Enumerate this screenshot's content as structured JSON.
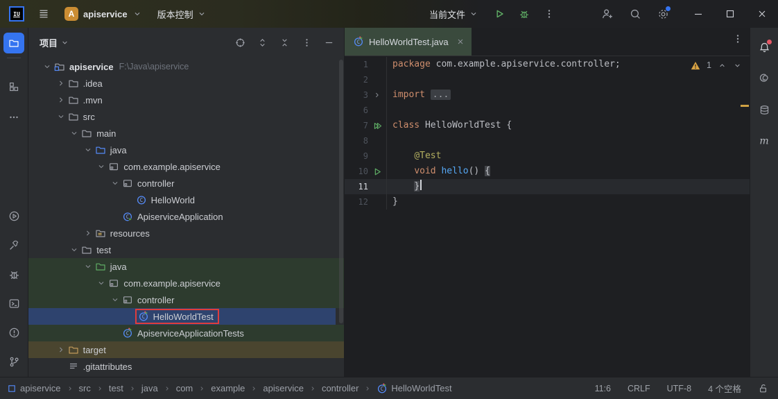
{
  "titlebar": {
    "project_name": "apiservice",
    "vcs_menu": "版本控制",
    "run_config": "当前文件",
    "avatar_letter": "A",
    "logo_text": "IU"
  },
  "colors": {
    "accent": "#3574f0",
    "selection_row": "#2e436e",
    "test_scope_row": "#2d3b2e",
    "excluded_row": "#4a452f",
    "active_tab": "#3a4a3d",
    "warning": "#d9a343",
    "annotation_box": "#e03c3c",
    "run_green": "#5fad65"
  },
  "left_stripe": {
    "top": [
      {
        "icon": "project-folder",
        "active": true
      },
      {
        "icon": "structure"
      },
      {
        "icon": "more-horizontal"
      }
    ],
    "bottom": [
      {
        "icon": "run"
      },
      {
        "icon": "build-hammer"
      },
      {
        "icon": "debug-bug"
      },
      {
        "icon": "terminal"
      },
      {
        "icon": "problems"
      },
      {
        "icon": "version-control"
      }
    ]
  },
  "right_stripe": [
    {
      "icon": "notifications",
      "badge": true
    },
    {
      "icon": "ai-assistant"
    },
    {
      "icon": "database"
    },
    {
      "icon": "maven"
    }
  ],
  "project_panel": {
    "title": "项目",
    "header_icons": [
      "locate",
      "expand-all",
      "collapse-all",
      "more-vertical",
      "hide"
    ],
    "tree": [
      {
        "level": 0,
        "chevron": "down",
        "icon": "project-root",
        "label": "apiservice",
        "root": true,
        "extra": "F:\\Java\\apiservice"
      },
      {
        "level": 1,
        "chevron": "right",
        "icon": "folder",
        "label": ".idea"
      },
      {
        "level": 1,
        "chevron": "right",
        "icon": "folder",
        "label": ".mvn"
      },
      {
        "level": 1,
        "chevron": "down",
        "icon": "folder",
        "label": "src"
      },
      {
        "level": 2,
        "chevron": "down",
        "icon": "folder",
        "label": "main"
      },
      {
        "level": 3,
        "chevron": "down",
        "icon": "folder-blue",
        "label": "java"
      },
      {
        "level": 4,
        "chevron": "down",
        "icon": "package",
        "label": "com.example.apiservice"
      },
      {
        "level": 5,
        "chevron": "down",
        "icon": "package",
        "label": "controller"
      },
      {
        "level": 6,
        "chevron": null,
        "icon": "class",
        "label": "HelloWorld"
      },
      {
        "level": 5,
        "chevron": null,
        "icon": "class-app",
        "label": "ApiserviceApplication"
      },
      {
        "level": 3,
        "chevron": "right",
        "icon": "folder-resources",
        "label": "resources"
      },
      {
        "level": 2,
        "chevron": "down",
        "icon": "folder",
        "label": "test"
      },
      {
        "level": 3,
        "chevron": "down",
        "icon": "folder-green",
        "label": "java",
        "bg": "green"
      },
      {
        "level": 4,
        "chevron": "down",
        "icon": "package",
        "label": "com.example.apiservice",
        "bg": "green"
      },
      {
        "level": 5,
        "chevron": "down",
        "icon": "package",
        "label": "controller",
        "bg": "green"
      },
      {
        "level": 6,
        "chevron": null,
        "icon": "class-test",
        "label": "HelloWorldTest",
        "bg": "selected",
        "boxed": true
      },
      {
        "level": 5,
        "chevron": null,
        "icon": "class-test",
        "label": "ApiserviceApplicationTests",
        "bg": "green"
      },
      {
        "level": 1,
        "chevron": "right",
        "icon": "folder-excluded",
        "label": "target",
        "bg": "excluded"
      },
      {
        "level": 1,
        "chevron": null,
        "icon": "file-text",
        "label": ".gitattributes"
      }
    ]
  },
  "editor": {
    "tab_label": "HelloWorldTest.java",
    "inspection_count": "1",
    "lines": [
      {
        "num": "1",
        "seg": [
          [
            "kw",
            "package"
          ],
          [
            "pl",
            " com.example.apiservice.controller;"
          ]
        ]
      },
      {
        "num": "2",
        "seg": []
      },
      {
        "num": "3",
        "gutter": "fold",
        "seg": [
          [
            "kw",
            "import"
          ],
          [
            "pl",
            " "
          ],
          [
            "fold",
            "..."
          ]
        ]
      },
      {
        "num": "6",
        "seg": []
      },
      {
        "num": "7",
        "gutter": "run-class",
        "seg": [
          [
            "kw",
            "class"
          ],
          [
            "pl",
            " HelloWorldTest {"
          ]
        ]
      },
      {
        "num": "8",
        "seg": []
      },
      {
        "num": "9",
        "seg": [
          [
            "pl",
            "    "
          ],
          [
            "ann",
            "@Test"
          ]
        ]
      },
      {
        "num": "10",
        "gutter": "run-method",
        "seg": [
          [
            "pl",
            "    "
          ],
          [
            "kw",
            "void"
          ],
          [
            "pl",
            " "
          ],
          [
            "mth",
            "hello"
          ],
          [
            "pl",
            "() "
          ],
          [
            "brace",
            "{"
          ]
        ]
      },
      {
        "num": "11",
        "current": true,
        "caret": true,
        "seg": [
          [
            "pl",
            "    "
          ],
          [
            "brace",
            "}"
          ]
        ]
      },
      {
        "num": "12",
        "seg": [
          [
            "pl",
            "}"
          ]
        ]
      }
    ]
  },
  "status_bar": {
    "breadcrumbs": [
      {
        "icon": "module",
        "label": "apiservice"
      },
      {
        "label": "src"
      },
      {
        "label": "test"
      },
      {
        "label": "java"
      },
      {
        "label": "com"
      },
      {
        "label": "example"
      },
      {
        "label": "apiservice"
      },
      {
        "label": "controller"
      },
      {
        "icon": "class-test",
        "label": "HelloWorldTest"
      }
    ],
    "caret_position": "11:6",
    "line_separator": "CRLF",
    "encoding": "UTF-8",
    "indent": "4 个空格"
  }
}
